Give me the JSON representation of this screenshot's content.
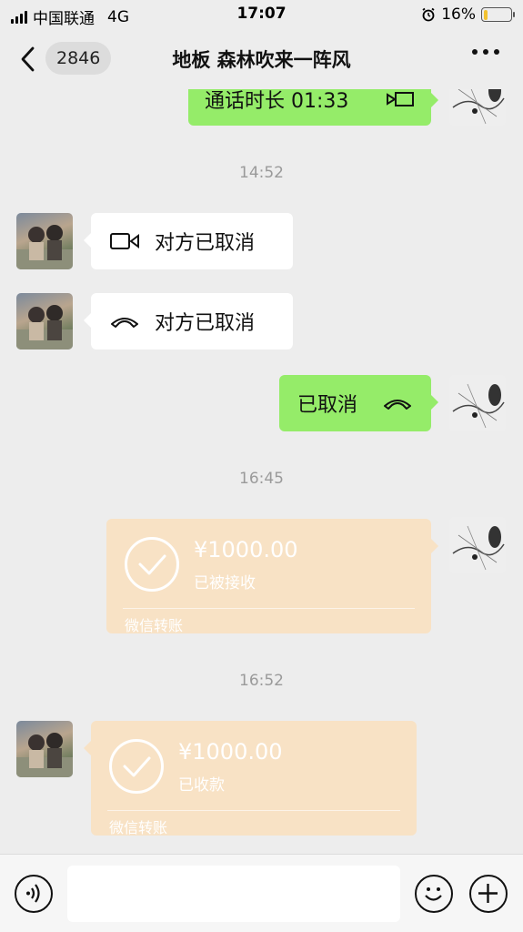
{
  "status_bar": {
    "carrier": "中国联通",
    "network": "4G",
    "time": "17:07",
    "battery_percent": "16%",
    "battery_level": 0.16,
    "alarm_icon": "alarm-clock-icon"
  },
  "nav": {
    "unread_count": "2846",
    "title": "地板 森林吹来一阵风",
    "back_icon": "chevron-left-icon",
    "more_icon": "more-dots-icon"
  },
  "messages": {
    "call_duration": "通话时长 01:33",
    "ts1": "14:52",
    "video_cancel": "对方已取消",
    "voice_cancel": "对方已取消",
    "my_cancel": "已取消",
    "ts2": "16:45",
    "transfer_sent": {
      "amount": "¥1000.00",
      "status": "已被接收",
      "footer": "微信转账"
    },
    "ts3": "16:52",
    "transfer_received": {
      "amount": "¥1000.00",
      "status": "已收款",
      "footer": "微信转账"
    }
  },
  "input_bar": {
    "placeholder": "",
    "voice_icon": "voice-icon",
    "emoji_icon": "emoji-icon",
    "plus_icon": "plus-icon"
  },
  "colors": {
    "background": "#ededed",
    "green_bubble": "#95ec69",
    "transfer_bubble": "#f8e2c5",
    "battery": "#f2c230"
  }
}
